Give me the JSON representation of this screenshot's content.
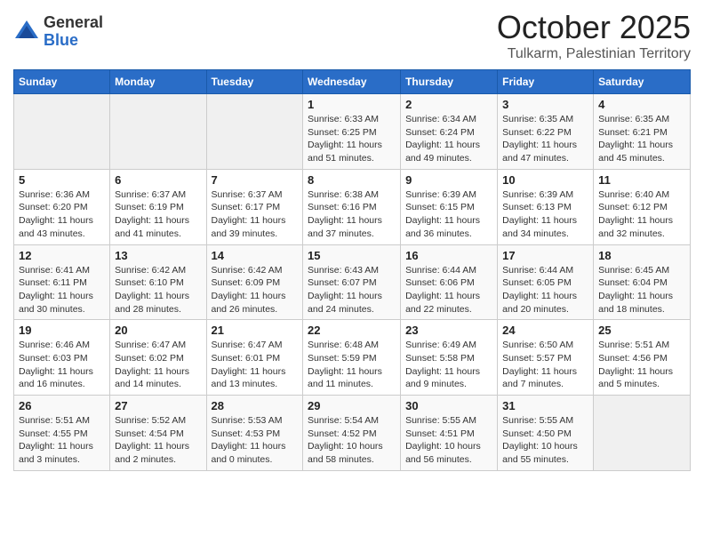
{
  "header": {
    "logo_general": "General",
    "logo_blue": "Blue",
    "month": "October 2025",
    "location": "Tulkarm, Palestinian Territory"
  },
  "weekdays": [
    "Sunday",
    "Monday",
    "Tuesday",
    "Wednesday",
    "Thursday",
    "Friday",
    "Saturday"
  ],
  "weeks": [
    [
      {
        "day": "",
        "info": ""
      },
      {
        "day": "",
        "info": ""
      },
      {
        "day": "",
        "info": ""
      },
      {
        "day": "1",
        "info": "Sunrise: 6:33 AM\nSunset: 6:25 PM\nDaylight: 11 hours\nand 51 minutes."
      },
      {
        "day": "2",
        "info": "Sunrise: 6:34 AM\nSunset: 6:24 PM\nDaylight: 11 hours\nand 49 minutes."
      },
      {
        "day": "3",
        "info": "Sunrise: 6:35 AM\nSunset: 6:22 PM\nDaylight: 11 hours\nand 47 minutes."
      },
      {
        "day": "4",
        "info": "Sunrise: 6:35 AM\nSunset: 6:21 PM\nDaylight: 11 hours\nand 45 minutes."
      }
    ],
    [
      {
        "day": "5",
        "info": "Sunrise: 6:36 AM\nSunset: 6:20 PM\nDaylight: 11 hours\nand 43 minutes."
      },
      {
        "day": "6",
        "info": "Sunrise: 6:37 AM\nSunset: 6:19 PM\nDaylight: 11 hours\nand 41 minutes."
      },
      {
        "day": "7",
        "info": "Sunrise: 6:37 AM\nSunset: 6:17 PM\nDaylight: 11 hours\nand 39 minutes."
      },
      {
        "day": "8",
        "info": "Sunrise: 6:38 AM\nSunset: 6:16 PM\nDaylight: 11 hours\nand 37 minutes."
      },
      {
        "day": "9",
        "info": "Sunrise: 6:39 AM\nSunset: 6:15 PM\nDaylight: 11 hours\nand 36 minutes."
      },
      {
        "day": "10",
        "info": "Sunrise: 6:39 AM\nSunset: 6:13 PM\nDaylight: 11 hours\nand 34 minutes."
      },
      {
        "day": "11",
        "info": "Sunrise: 6:40 AM\nSunset: 6:12 PM\nDaylight: 11 hours\nand 32 minutes."
      }
    ],
    [
      {
        "day": "12",
        "info": "Sunrise: 6:41 AM\nSunset: 6:11 PM\nDaylight: 11 hours\nand 30 minutes."
      },
      {
        "day": "13",
        "info": "Sunrise: 6:42 AM\nSunset: 6:10 PM\nDaylight: 11 hours\nand 28 minutes."
      },
      {
        "day": "14",
        "info": "Sunrise: 6:42 AM\nSunset: 6:09 PM\nDaylight: 11 hours\nand 26 minutes."
      },
      {
        "day": "15",
        "info": "Sunrise: 6:43 AM\nSunset: 6:07 PM\nDaylight: 11 hours\nand 24 minutes."
      },
      {
        "day": "16",
        "info": "Sunrise: 6:44 AM\nSunset: 6:06 PM\nDaylight: 11 hours\nand 22 minutes."
      },
      {
        "day": "17",
        "info": "Sunrise: 6:44 AM\nSunset: 6:05 PM\nDaylight: 11 hours\nand 20 minutes."
      },
      {
        "day": "18",
        "info": "Sunrise: 6:45 AM\nSunset: 6:04 PM\nDaylight: 11 hours\nand 18 minutes."
      }
    ],
    [
      {
        "day": "19",
        "info": "Sunrise: 6:46 AM\nSunset: 6:03 PM\nDaylight: 11 hours\nand 16 minutes."
      },
      {
        "day": "20",
        "info": "Sunrise: 6:47 AM\nSunset: 6:02 PM\nDaylight: 11 hours\nand 14 minutes."
      },
      {
        "day": "21",
        "info": "Sunrise: 6:47 AM\nSunset: 6:01 PM\nDaylight: 11 hours\nand 13 minutes."
      },
      {
        "day": "22",
        "info": "Sunrise: 6:48 AM\nSunset: 5:59 PM\nDaylight: 11 hours\nand 11 minutes."
      },
      {
        "day": "23",
        "info": "Sunrise: 6:49 AM\nSunset: 5:58 PM\nDaylight: 11 hours\nand 9 minutes."
      },
      {
        "day": "24",
        "info": "Sunrise: 6:50 AM\nSunset: 5:57 PM\nDaylight: 11 hours\nand 7 minutes."
      },
      {
        "day": "25",
        "info": "Sunrise: 5:51 AM\nSunset: 4:56 PM\nDaylight: 11 hours\nand 5 minutes."
      }
    ],
    [
      {
        "day": "26",
        "info": "Sunrise: 5:51 AM\nSunset: 4:55 PM\nDaylight: 11 hours\nand 3 minutes."
      },
      {
        "day": "27",
        "info": "Sunrise: 5:52 AM\nSunset: 4:54 PM\nDaylight: 11 hours\nand 2 minutes."
      },
      {
        "day": "28",
        "info": "Sunrise: 5:53 AM\nSunset: 4:53 PM\nDaylight: 11 hours\nand 0 minutes."
      },
      {
        "day": "29",
        "info": "Sunrise: 5:54 AM\nSunset: 4:52 PM\nDaylight: 10 hours\nand 58 minutes."
      },
      {
        "day": "30",
        "info": "Sunrise: 5:55 AM\nSunset: 4:51 PM\nDaylight: 10 hours\nand 56 minutes."
      },
      {
        "day": "31",
        "info": "Sunrise: 5:55 AM\nSunset: 4:50 PM\nDaylight: 10 hours\nand 55 minutes."
      },
      {
        "day": "",
        "info": ""
      }
    ]
  ]
}
